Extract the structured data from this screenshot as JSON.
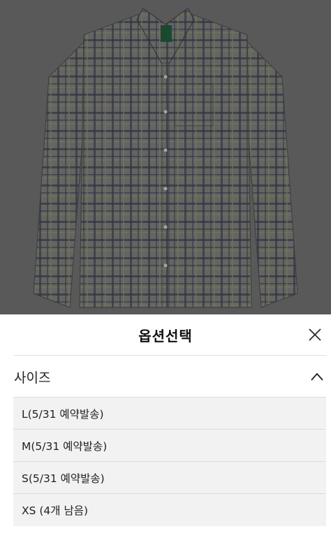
{
  "product": {
    "image_alt": "checked shirt product photo",
    "colors": {
      "plaid_base": "#7a7c78",
      "plaid_dark": "#3d4250",
      "plaid_green": "#8a9070",
      "label": "#1f5a3a"
    }
  },
  "sheet": {
    "title": "옵션선택",
    "close_icon": "close-icon",
    "size_section": {
      "label": "사이즈",
      "expanded": true,
      "toggle_icon": "chevron-up-icon"
    },
    "options": [
      {
        "label": "L(5/31 예약발송)"
      },
      {
        "label": "M(5/31 예약발송)"
      },
      {
        "label": "S(5/31 예약발송)"
      },
      {
        "label": "XS (4개 남음)"
      }
    ]
  }
}
